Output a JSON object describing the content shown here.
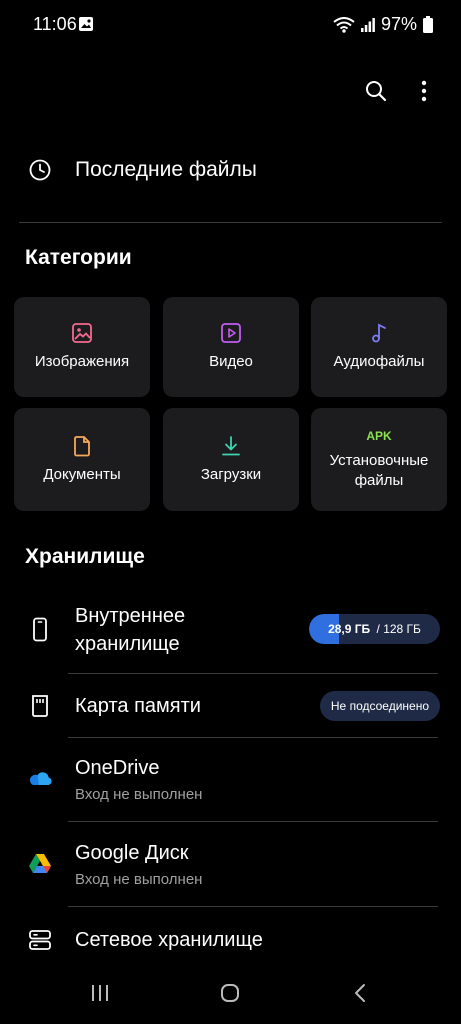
{
  "status_bar": {
    "time": "11:06",
    "battery": "97%"
  },
  "toolbar": {
    "search_icon": "search-icon",
    "more_icon": "more-vertical-icon"
  },
  "recent": {
    "label": "Последние файлы"
  },
  "categories": {
    "title": "Категории",
    "items": [
      {
        "label": "Изображения",
        "icon": "image-icon"
      },
      {
        "label": "Видео",
        "icon": "video-icon"
      },
      {
        "label": "Аудиофайлы",
        "icon": "music-note-icon"
      },
      {
        "label": "Документы",
        "icon": "document-icon"
      },
      {
        "label": "Загрузки",
        "icon": "download-icon"
      },
      {
        "label_line1": "Установочные",
        "label_line2": "файлы",
        "badge": "APK"
      }
    ]
  },
  "storage": {
    "title": "Хранилище",
    "internal": {
      "line1": "Внутреннее",
      "line2": "хранилище",
      "used": "28,9 ГБ",
      "total": " / 128 ГБ",
      "used_fraction": 0.226
    },
    "card": {
      "title": "Карта памяти",
      "status": "Не подсоединено"
    },
    "onedrive": {
      "title": "OneDrive",
      "subtitle": "Вход не выполнен"
    },
    "gdrive": {
      "title": "Google Диск",
      "subtitle": "Вход не выполнен"
    },
    "network": {
      "title": "Сетевое хранилище"
    }
  },
  "colors": {
    "accent": "#2f6fe0",
    "tile_bg": "#1c1c1e",
    "apk_green": "#8ae24e"
  }
}
